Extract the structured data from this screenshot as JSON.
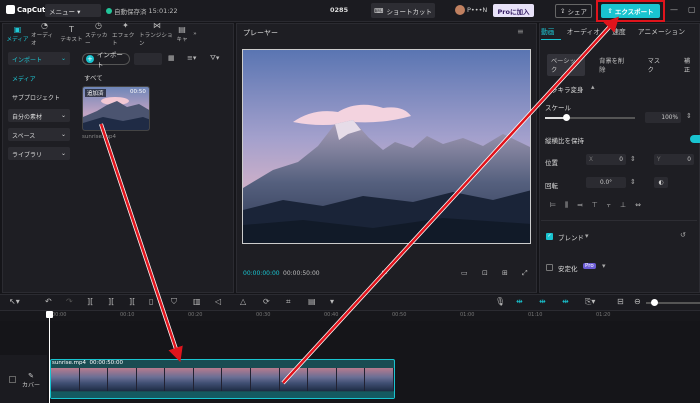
{
  "app": {
    "logo": "CapCut"
  },
  "topbar": {
    "menu_label": "メニュー",
    "autosave": "自動保存済",
    "autosave_time": "15:01:22",
    "project_title": "0285",
    "shortcut_label": "ショートカット",
    "user_name": "P•••N",
    "pro_label": "Proに加入",
    "share_label": "シェア",
    "export_label": "エクスポート"
  },
  "media_tabs": [
    {
      "label": "メディア",
      "icon": "media-icon"
    },
    {
      "label": "オーディオ",
      "icon": "audio-icon"
    },
    {
      "label": "テキスト",
      "icon": "text-icon"
    },
    {
      "label": "ステッカー",
      "icon": "sticker-icon"
    },
    {
      "label": "エフェクト",
      "icon": "effect-icon"
    },
    {
      "label": "トランジション",
      "icon": "transition-icon"
    },
    {
      "label": "キャ",
      "icon": "caption-icon"
    }
  ],
  "sidebar": {
    "items": [
      {
        "label": "インポート"
      },
      {
        "label": "メディア"
      },
      {
        "label": "サブプロジェクト"
      },
      {
        "label": "自分の素材"
      },
      {
        "label": "スペース"
      },
      {
        "label": "ライブラリ"
      }
    ]
  },
  "media": {
    "import_label": "インポート",
    "all_label": "すべて",
    "thumb_added": "追加済",
    "thumb_duration": "00:50",
    "thumb_name": "sunrise.mp4"
  },
  "player": {
    "title": "プレーヤー",
    "time_current": "00:00:00:00",
    "time_total": "00:00:50:00"
  },
  "inspector": {
    "tabs": [
      "動画",
      "オーディオ",
      "速度",
      "アニメーション"
    ],
    "subtabs": [
      "ベーシック",
      "背景を削除",
      "マスク",
      "補正"
    ],
    "transform_label": "ラキラ変身",
    "scale_label": "スケール",
    "scale_value": "100%",
    "keep_ratio_label": "縦横比を保持",
    "position_label": "位置",
    "pos_x_label": "X",
    "pos_x": "0",
    "pos_y_label": "Y",
    "pos_y": "0",
    "rotate_label": "回転",
    "rotate_value": "0.0°",
    "blend_label": "ブレンド",
    "stabilize_label": "安定化",
    "stabilize_badge": "Pro"
  },
  "timeline": {
    "ruler": [
      "00:00",
      "00:10",
      "00:20",
      "00:30",
      "00:40",
      "00:50",
      "01:00",
      "01:10",
      "01:20"
    ],
    "cover_label": "カバー",
    "clip_name": "sunrise.mp4",
    "clip_duration": "00:00:50:00"
  },
  "colors": {
    "accent": "#19c4d0",
    "highlight": "#e0141c",
    "background": "#151519"
  }
}
